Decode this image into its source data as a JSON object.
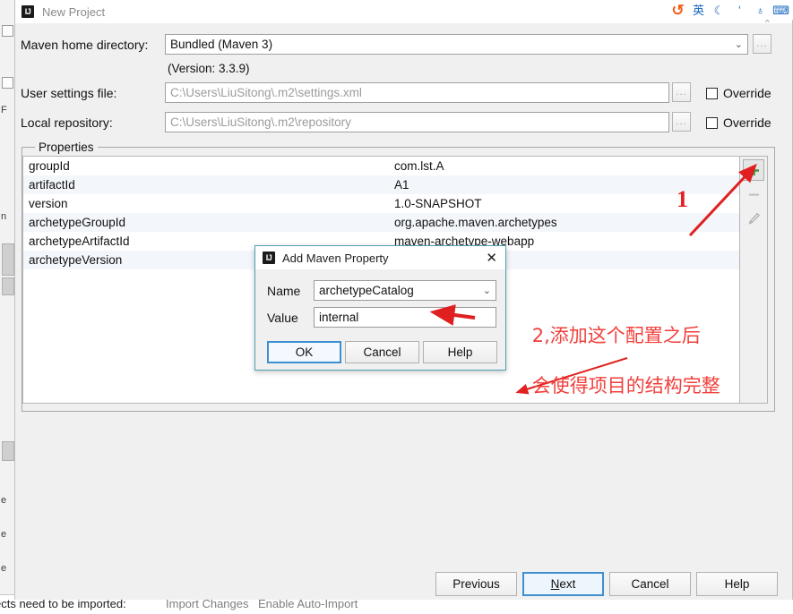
{
  "background": {
    "notification": {
      "message": "ects need to be imported:",
      "action_import": "Import Changes",
      "action_auto": "Enable Auto-Import"
    },
    "left_strip_marks": [
      "n",
      "e",
      "e",
      "e",
      "ects"
    ]
  },
  "ime_toolbar": {
    "items": [
      {
        "name": "sogou-logo-icon",
        "glyph": "↺"
      },
      {
        "name": "english-mode-icon",
        "glyph": "英"
      },
      {
        "name": "moon-icon",
        "glyph": "☾"
      },
      {
        "name": "comma-icon",
        "glyph": "ʻ"
      },
      {
        "name": "microphone-icon",
        "glyph": "♁"
      },
      {
        "name": "keyboard-icon",
        "glyph": "⌨"
      }
    ],
    "caret": "⌃"
  },
  "wizard": {
    "title": "New Project",
    "logo": "IJ",
    "maven_home": {
      "label": "Maven home directory:",
      "value": "Bundled (Maven 3)",
      "chevron": "⌄",
      "browse": "...",
      "version_note": "(Version: 3.3.9)"
    },
    "user_settings": {
      "label": "User settings file:",
      "value": "C:\\Users\\LiuSitong\\.m2\\settings.xml",
      "browse": "...",
      "override_label": "Override"
    },
    "local_repository": {
      "label": "Local repository:",
      "value": "C:\\Users\\LiuSitong\\.m2\\repository",
      "browse": "...",
      "override_label": "Override"
    },
    "properties": {
      "legend": "Properties",
      "rows": [
        {
          "key": "groupId",
          "value": "com.lst.A"
        },
        {
          "key": "artifactId",
          "value": "A1"
        },
        {
          "key": "version",
          "value": "1.0-SNAPSHOT"
        },
        {
          "key": "archetypeGroupId",
          "value": "org.apache.maven.archetypes"
        },
        {
          "key": "archetypeArtifactId",
          "value": "maven-archetype-webapp"
        },
        {
          "key": "archetypeVersion",
          "value": ""
        }
      ],
      "toolbar": {
        "add": "+",
        "remove": "–",
        "edit": "✎"
      }
    },
    "buttons": {
      "previous": "Previous",
      "next_prefix": "",
      "next_accel": "N",
      "next_suffix": "ext",
      "cancel": "Cancel",
      "help": "Help"
    }
  },
  "add_property_dialog": {
    "title": "Add Maven Property",
    "logo": "IJ",
    "close": "✕",
    "name_label": "Name",
    "name_value": "archetypeCatalog",
    "name_chevron": "⌄",
    "value_label": "Value",
    "value_value": "internal",
    "ok": "OK",
    "cancel": "Cancel",
    "help": "Help"
  },
  "annotations": {
    "marker_one": "1",
    "note_line1": "2,添加这个配置之后",
    "note_line2": "会使得项目的结构完整",
    "color": "#e8302c"
  }
}
